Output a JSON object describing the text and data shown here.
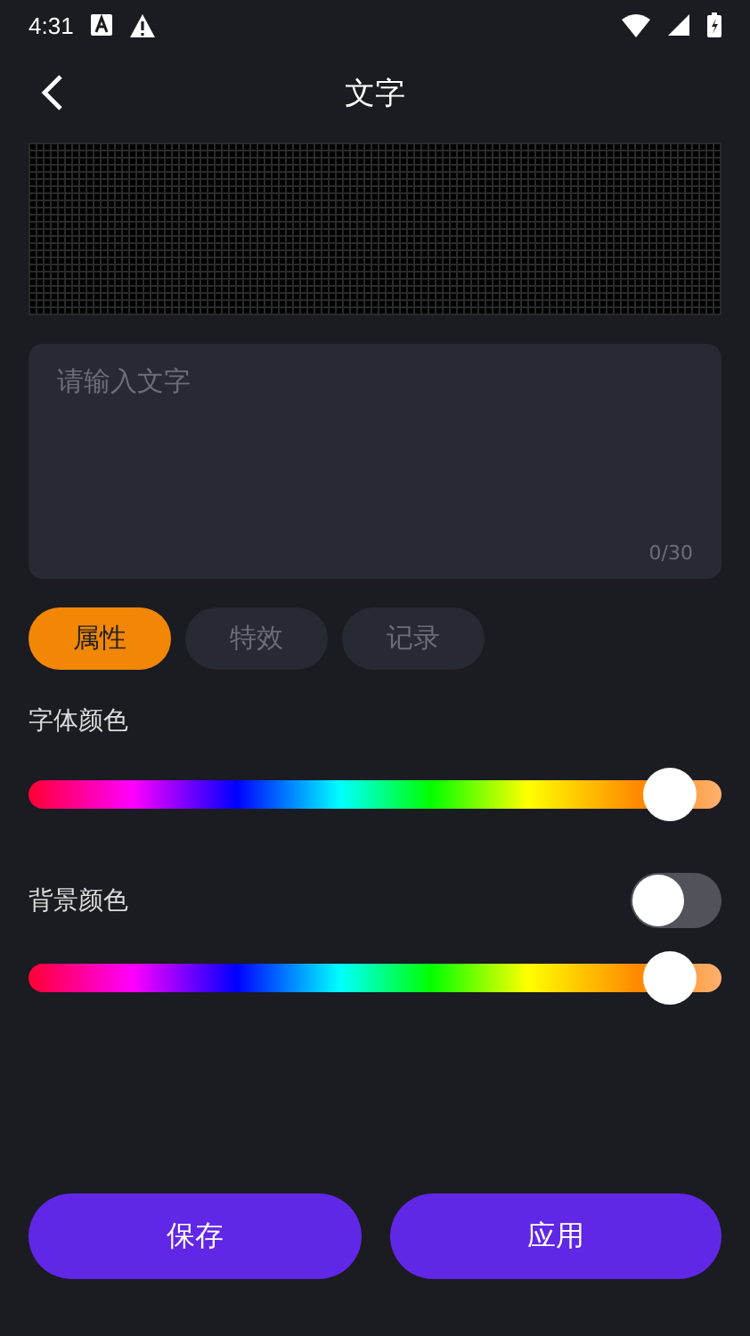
{
  "status_bar": {
    "time": "4:31"
  },
  "header": {
    "title": "文字"
  },
  "text_input": {
    "placeholder": "请输入文字",
    "counter": "0/30"
  },
  "tabs": [
    {
      "label": "属性",
      "selected": true
    },
    {
      "label": "特效",
      "selected": false
    },
    {
      "label": "记录",
      "selected": false
    }
  ],
  "font_color": {
    "label": "字体颜色",
    "level": 0.96
  },
  "background_color": {
    "label": "背景颜色",
    "on": false,
    "level": 0.96
  },
  "buttons": [
    "保存",
    "应用"
  ]
}
